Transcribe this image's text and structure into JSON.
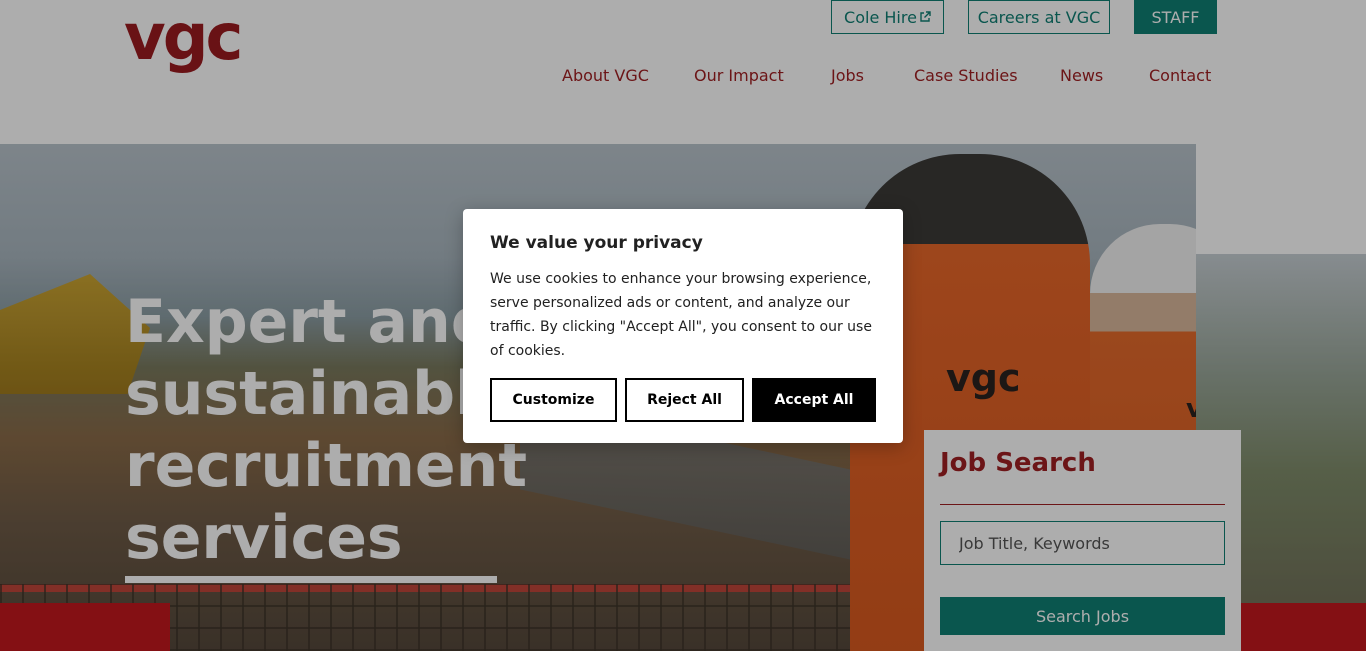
{
  "header": {
    "logo_text": "vgc",
    "top_links": {
      "cole_hire": "Cole Hire",
      "careers": "Careers at VGC",
      "staff": "STAFF"
    },
    "nav": {
      "about": "About VGC",
      "impact": "Our Impact",
      "jobs": "Jobs",
      "cases": "Case Studies",
      "news": "News",
      "contact": "Contact"
    }
  },
  "hero": {
    "title": "Expert and sustainable recruitment services",
    "vest_logo_a": "vgc",
    "vest_logo_b": "vgc"
  },
  "job_search": {
    "title": "Job Search",
    "input_placeholder": "Job Title, Keywords",
    "button": "Search Jobs"
  },
  "cookie_dialog": {
    "title": "We value your privacy",
    "text": "We use cookies to enhance your browsing experience, serve personalized ads or content, and analyze our traffic. By clicking \"Accept All\", you consent to our use of cookies.",
    "customize": "Customize",
    "reject": "Reject All",
    "accept": "Accept All"
  },
  "colors": {
    "brand_red": "#a01f22",
    "brand_teal": "#0f7f74",
    "accent_red": "#c3181e"
  }
}
